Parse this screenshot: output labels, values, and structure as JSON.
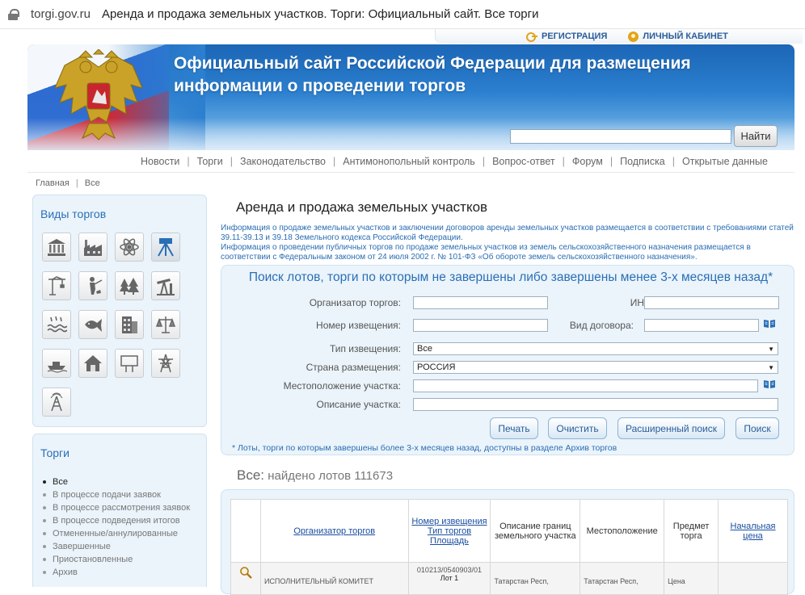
{
  "browser": {
    "host": "torgi.gov.ru",
    "title": "Аренда и продажа земельных участков. Торги: Официальный сайт. Все торги"
  },
  "toplinks": {
    "register": "РЕГИСТРАЦИЯ",
    "cabinet": "ЛИЧНЫЙ КАБИНЕТ",
    "sep": "|"
  },
  "header": {
    "title": "Официальный сайт Российской Федерации для размещения информации о проведении торгов",
    "search_value": "",
    "search_button": "Найти"
  },
  "nav": [
    "Новости",
    "Торги",
    "Законодательство",
    "Антимонопольный контроль",
    "Вопрос-ответ",
    "Форум",
    "Подписка",
    "Открытые данные"
  ],
  "breadcrumb": {
    "home": "Главная",
    "current": "Все"
  },
  "sidebar": {
    "types_title": "Виды торгов",
    "type_icons": [
      "bank-icon",
      "factory-icon",
      "atom-icon",
      "surveyor-icon",
      "crane-icon",
      "hunter-icon",
      "forest-icon",
      "oil-pump-icon",
      "water-icon",
      "fish-icon",
      "building-icon",
      "scales-icon",
      "boat-icon",
      "house-icon",
      "billboard-icon",
      "power-tower-icon",
      "antenna-icon"
    ],
    "auctions_title": "Торги",
    "statuses": [
      "Все",
      "В процессе подачи заявок",
      "В процессе рассмотрения заявок",
      "В процессе подведения итогов",
      "Отмененные/аннулированные",
      "Завершенные",
      "Приостановленные",
      "Архив"
    ]
  },
  "main": {
    "title": "Аренда и продажа земельных участков",
    "info": [
      "Информация о продаже земельных участков и заключении договоров аренды земельных участков размещается в соответствии с требованиями статей 39.11-39.13 и 39.18 Земельного кодекса Российской Федерации.",
      "Информация о проведении публичных торгов по продаже земельных участков из земель сельскохозяйственного назначения размещается в соответствии с Федеральным законом от 24 июля 2002 г. № 101-ФЗ «Об обороте земель сельскохозяйственного назначения»."
    ]
  },
  "search": {
    "title": "Поиск лотов, торги по которым не завершены либо завершены менее 3-х месяцев назад*",
    "organizer_label": "Организатор торгов:",
    "organizer_value": "",
    "inn_label": "ИНН:",
    "inn_value": "",
    "notice_label": "Номер извещения:",
    "notice_value": "",
    "contract_label": "Вид договора:",
    "contract_value": "",
    "notice_type_label": "Тип извещения:",
    "notice_type_value": "Все",
    "country_label": "Страна размещения:",
    "country_value": "РОССИЯ",
    "location_label": "Местоположение участка:",
    "location_value": "",
    "description_label": "Описание участка:",
    "description_value": "",
    "buttons": {
      "print": "Печать",
      "clear": "Очистить",
      "advanced": "Расширенный поиск",
      "search": "Поиск"
    },
    "note": "* Лоты, торги по которым завершены более 3-х месяцев назад, доступны в разделе Архив торгов"
  },
  "results": {
    "prefix": "Все:",
    "found": "найдено лотов 111673",
    "headers": {
      "organizer": "Организатор торгов",
      "notice_no": "Номер извещения",
      "auction_type": "Тип торгов",
      "site": "Площадь",
      "description": "Описание границ земельного участка",
      "location": "Местоположение",
      "subject": "Предмет торга",
      "price": "Начальная цена"
    },
    "row1": {
      "organizer": "ИСПОЛНИТЕЛЬНЫЙ КОМИТЕТ",
      "notice": "010213/0540903/01",
      "lot": "Лот 1",
      "description": "Татарстан Респ,",
      "location": "Татарстан Респ,",
      "subject": "Цена"
    }
  }
}
